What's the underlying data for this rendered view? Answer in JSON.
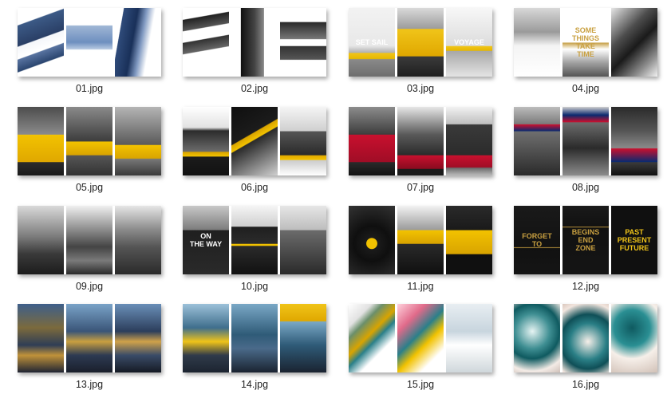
{
  "tiles": [
    {
      "label": "01.jpg",
      "panels": [
        {
          "bg": "linear-gradient(160deg,#ffffff 0%,#ffffff 20%,#3c5a86 21%,#2a3f66 45%,#f4f6fa 46%,#ffffff 60%,#5873a0 61%,#2b4670 75%,#ffffff 76%)"
        },
        {
          "bg": "linear-gradient(180deg,#ffffff 25%,#9fb6d5 26%,#6e8fbf 50%,#b7c9e1 60%,#ffffff 61%)"
        },
        {
          "bg": "linear-gradient(100deg,#ffffff 15%,#2f4b7a 16%,#193059 40%,#7f98c0 55%,#ffffff 70%)"
        }
      ]
    },
    {
      "label": "02.jpg",
      "panels": [
        {
          "bg": "linear-gradient(170deg,#ffffff 15%,#222 16%,#555 30%,#ffffff 31%,#ffffff 45%,#333 46%,#666 60%,#ffffff 61%)"
        },
        {
          "bg": "linear-gradient(90deg,#ffffff 20%,#111 21%,#444 50%,#888 70%,#ffffff 71%)"
        },
        {
          "bg": "linear-gradient(180deg,#ffffff 20%,#2a2a2a 21%,#777 45%,#ffffff 46%,#ffffff 55%,#333 56%,#555 75%,#ffffff 76%)"
        }
      ]
    },
    {
      "label": "03.jpg",
      "panels": [
        {
          "bg": "linear-gradient(180deg,#f2f2f2 0%,#e8e8e8 55%,#b0b0b0 65%,#f0c419 66%,#e6b800 74%,#8a8a8a 75%,#6d6d6d 100%)",
          "mark": "SET SAIL"
        },
        {
          "bg": "linear-gradient(180deg,#d9d9d9 0%,#9c9c9c 30%,#f0c419 31%,#e0a800 70%,#3a3a3a 71%,#1f1f1f 100%)"
        },
        {
          "bg": "linear-gradient(180deg,#f7f7f7 0%,#dcdcdc 55%,#f0c419 56%,#e6b800 62%,#a8a8a8 63%,#e4e4e4 100%)",
          "mark": "VOYAGE"
        }
      ]
    },
    {
      "label": "04.jpg",
      "panels": [
        {
          "bg": "linear-gradient(180deg,#d8d8d8 0%,#9a9a9a 35%,#f4f4f4 55%,#ffffff 100%)"
        },
        {
          "bg": "linear-gradient(180deg,#ffffff 0%,#ffffff 50%,#c8a24a 51%,#ffffff 60%,#a0a0a0 80%,#555 100%)",
          "mark": "SOME\nTHINGS\nTAKE\nTIME"
        },
        {
          "bg": "linear-gradient(135deg,#e6e6e6 0%,#4d4d4d 35%,#1a1a1a 55%,#8c8c8c 80%,#f2f2f2 100%)"
        }
      ]
    },
    {
      "label": "05.jpg",
      "panels": [
        {
          "bg": "linear-gradient(180deg,#4d4d4d 0%,#8a8a8a 40%,#f2c200 41%,#e0a800 80%,#2b2b2b 81%,#1a1a1a 100%)"
        },
        {
          "bg": "linear-gradient(180deg,#8a8a8a 0%,#3d3d3d 50%,#f2c200 51%,#d9a400 70%,#555 71%,#333 100%)"
        },
        {
          "bg": "linear-gradient(180deg,#b5b5b5 0%,#5a5a5a 55%,#f2c200 56%,#d9a400 75%,#777 76%,#3a3a3a 100%)"
        }
      ]
    },
    {
      "label": "06.jpg",
      "panels": [
        {
          "bg": "linear-gradient(180deg,#ffffff 0%,#e2e2e2 30%,#2c2c2c 35%,#6b6b6b 65%,#d9a400 66%,#f2c200 72%,#1b1b1b 73%,#121212 100%)"
        },
        {
          "bg": "linear-gradient(150deg,#0f0f0f 0%,#1c1c1c 40%,#d9a400 41%,#f2c200 48%,#2a2a2a 49%,#d0d0d0 100%)"
        },
        {
          "bg": "linear-gradient(180deg,#f5f5f5 0%,#d0d0d0 35%,#555 36%,#2a2a2a 70%,#e0a800 71%,#f2c200 77%,#cccccc 78%,#ffffff 100%)"
        }
      ]
    },
    {
      "label": "07.jpg",
      "panels": [
        {
          "bg": "linear-gradient(180deg,#8c8c8c 0%,#3d3d3d 40%,#c8102e 41%,#a00d26 80%,#2a2a2a 81%,#121212 100%)"
        },
        {
          "bg": "linear-gradient(180deg,#e6e6e6 0%,#5a5a5a 40%,#2b2b2b 70%,#c8102e 71%,#8a0b1f 90%,#1b1b1b 91%)"
        },
        {
          "bg": "linear-gradient(180deg,#f2f2f2 0%,#bfbfbf 25%,#3a3a3a 26%,#2b2b2b 70%,#c8102e 71%,#a00d26 88%,#6a6a6a 89%,#bbbbbb 100%)"
        }
      ]
    },
    {
      "label": "08.jpg",
      "panels": [
        {
          "bg": "linear-gradient(180deg,#bcbcbc 0%,#7a7a7a 25%,#c8102e 26%,#0b2a6f 35%,#6f6f6f 36%,#2a2a2a 100%)"
        },
        {
          "bg": "linear-gradient(180deg,#cfcfcf 0%,#0b2a6f 12%,#c8102e 22%,#6b6b6b 23%,#2b2b2b 60%,#8c8c8c 100%)"
        },
        {
          "bg": "linear-gradient(180deg,#2a2a2a 0%,#555 35%,#8a8a8a 60%,#c8102e 61%,#0b2a6f 80%,#3a3a3a 81%,#111 100%)"
        }
      ]
    },
    {
      "label": "09.jpg",
      "panels": [
        {
          "bg": "linear-gradient(180deg,#d9d9d9 0%,#7b7b7b 45%,#3a3a3a 70%,#1c1c1c 100%)"
        },
        {
          "bg": "linear-gradient(180deg,#f0f0f0 0%,#9a9a9a 30%,#444 60%,#7a7a7a 80%,#2a2a2a 100%)"
        },
        {
          "bg": "linear-gradient(180deg,#e6e6e6 0%,#8a8a8a 35%,#555 60%,#2a2a2a 100%)"
        }
      ]
    },
    {
      "label": "10.jpg",
      "panels": [
        {
          "bg": "linear-gradient(180deg,#c8c8c8 0%,#7c7c7c 35%,#1f1f1f 36%,#2a2a2a 100%)",
          "mark": "ON\nTHE WAY"
        },
        {
          "bg": "linear-gradient(180deg,#f5f5f5 0%,#cfcfcf 30%,#1f1f1f 31%,#2b2b2b 55%,#f2c200 56%,#f2c200 58%,#2b2b2b 59%,#111 100%)"
        },
        {
          "bg": "linear-gradient(180deg,#e6e6e6 0%,#bdbdbd 35%,#6b6b6b 36%,#2a2a2a 100%)"
        }
      ]
    },
    {
      "label": "11.jpg",
      "panels": [
        {
          "bg": "radial-gradient(circle at 50% 55%,#f2c200 0%,#f2c200 12%,#1b1b1b 13%,#0f0f0f 40%,#333 100%)"
        },
        {
          "bg": "linear-gradient(180deg,#f2f2f2 0%,#9b9b9b 35%,#f2c200 36%,#d9a400 55%,#2a2a2a 56%,#0f0f0f 100%)"
        },
        {
          "bg": "linear-gradient(180deg,#2a2a2a 0%,#1a1a1a 35%,#f2c200 36%,#d9a400 70%,#0f0f0f 71%,#111 100%)"
        }
      ]
    },
    {
      "label": "12.jpg",
      "panels": [
        {
          "bg": "linear-gradient(180deg,#1a1a1a 0%,#111 60%,#c9a040 61%,#111 62%,#151515 100%)",
          "mark": "FORGET\nTO"
        },
        {
          "bg": "linear-gradient(180deg,#1a1a1a 0%,#111 30%,#c9a040 31%,#111 32%,#151515 100%)",
          "mark": "BEGINS\nEND\nZONE"
        },
        {
          "bg": "linear-gradient(180deg,#101010 0%,#101010 100%)",
          "mark": "PAST\nPRESENT\nFUTURE"
        }
      ]
    },
    {
      "label": "13.jpg",
      "panels": [
        {
          "bg": "linear-gradient(180deg,#3e5f8a 0%,#7b6a3c 35%,#2f3d55 60%,#c0923a 75%,#1f2433 100%)"
        },
        {
          "bg": "linear-gradient(180deg,#7aa3c8 0%,#3a5578 40%,#c9a040 55%,#2d3a52 75%,#1a1f2b 100%)"
        },
        {
          "bg": "linear-gradient(180deg,#6a8fb8 0%,#2c3e5c 40%,#d0a24a 55%,#3a4b67 75%,#151a24 100%)"
        }
      ]
    },
    {
      "label": "14.jpg",
      "panels": [
        {
          "bg": "linear-gradient(180deg,#9cc1d9 0%,#3f6e8c 35%,#f0c419 55%,#2f3a4a 75%,#1c2430 100%)"
        },
        {
          "bg": "linear-gradient(180deg,#7aa8c6 0%,#2f5b78 45%,#4a6a8a 65%,#1a2330 100%)"
        },
        {
          "bg": "linear-gradient(180deg,#f0c419 0%,#e0a800 25%,#7aa8c6 26%,#2f5b78 60%,#1a2330 100%)"
        }
      ]
    },
    {
      "label": "15.jpg",
      "panels": [
        {
          "bg": "linear-gradient(135deg,#ffffff 0%,#e2e2e2 20%,#6b8f6b 30%,#d9a400 45%,#2a7f8a 55%,#ffffff 70%)"
        },
        {
          "bg": "linear-gradient(135deg,#ffd1dc 0%,#e06a8a 25%,#2a7f8a 45%,#f2c200 60%,#ffffff 80%)"
        },
        {
          "bg": "linear-gradient(180deg,#e8eef2 0%,#c8d5de 40%,#ffffff 60%,#cfd7db 100%)"
        }
      ]
    },
    {
      "label": "16.jpg",
      "panels": [
        {
          "bg": "radial-gradient(circle at 40% 40%,#e6f4f3 0%,#3f8f93 35%,#0f5a60 55%,#f3ebe6 80%,#cfc0b8 100%)"
        },
        {
          "bg": "radial-gradient(circle at 55% 55%,#f6efe9 0%,#2a7f86 40%,#0f4f57 60%,#f2e5de 85%,#d9c6bc 100%)"
        },
        {
          "bg": "radial-gradient(circle at 45% 35%,#0f5a60 0%,#2a8f93 35%,#f6efe9 60%,#d1c1b7 100%)"
        }
      ]
    }
  ]
}
